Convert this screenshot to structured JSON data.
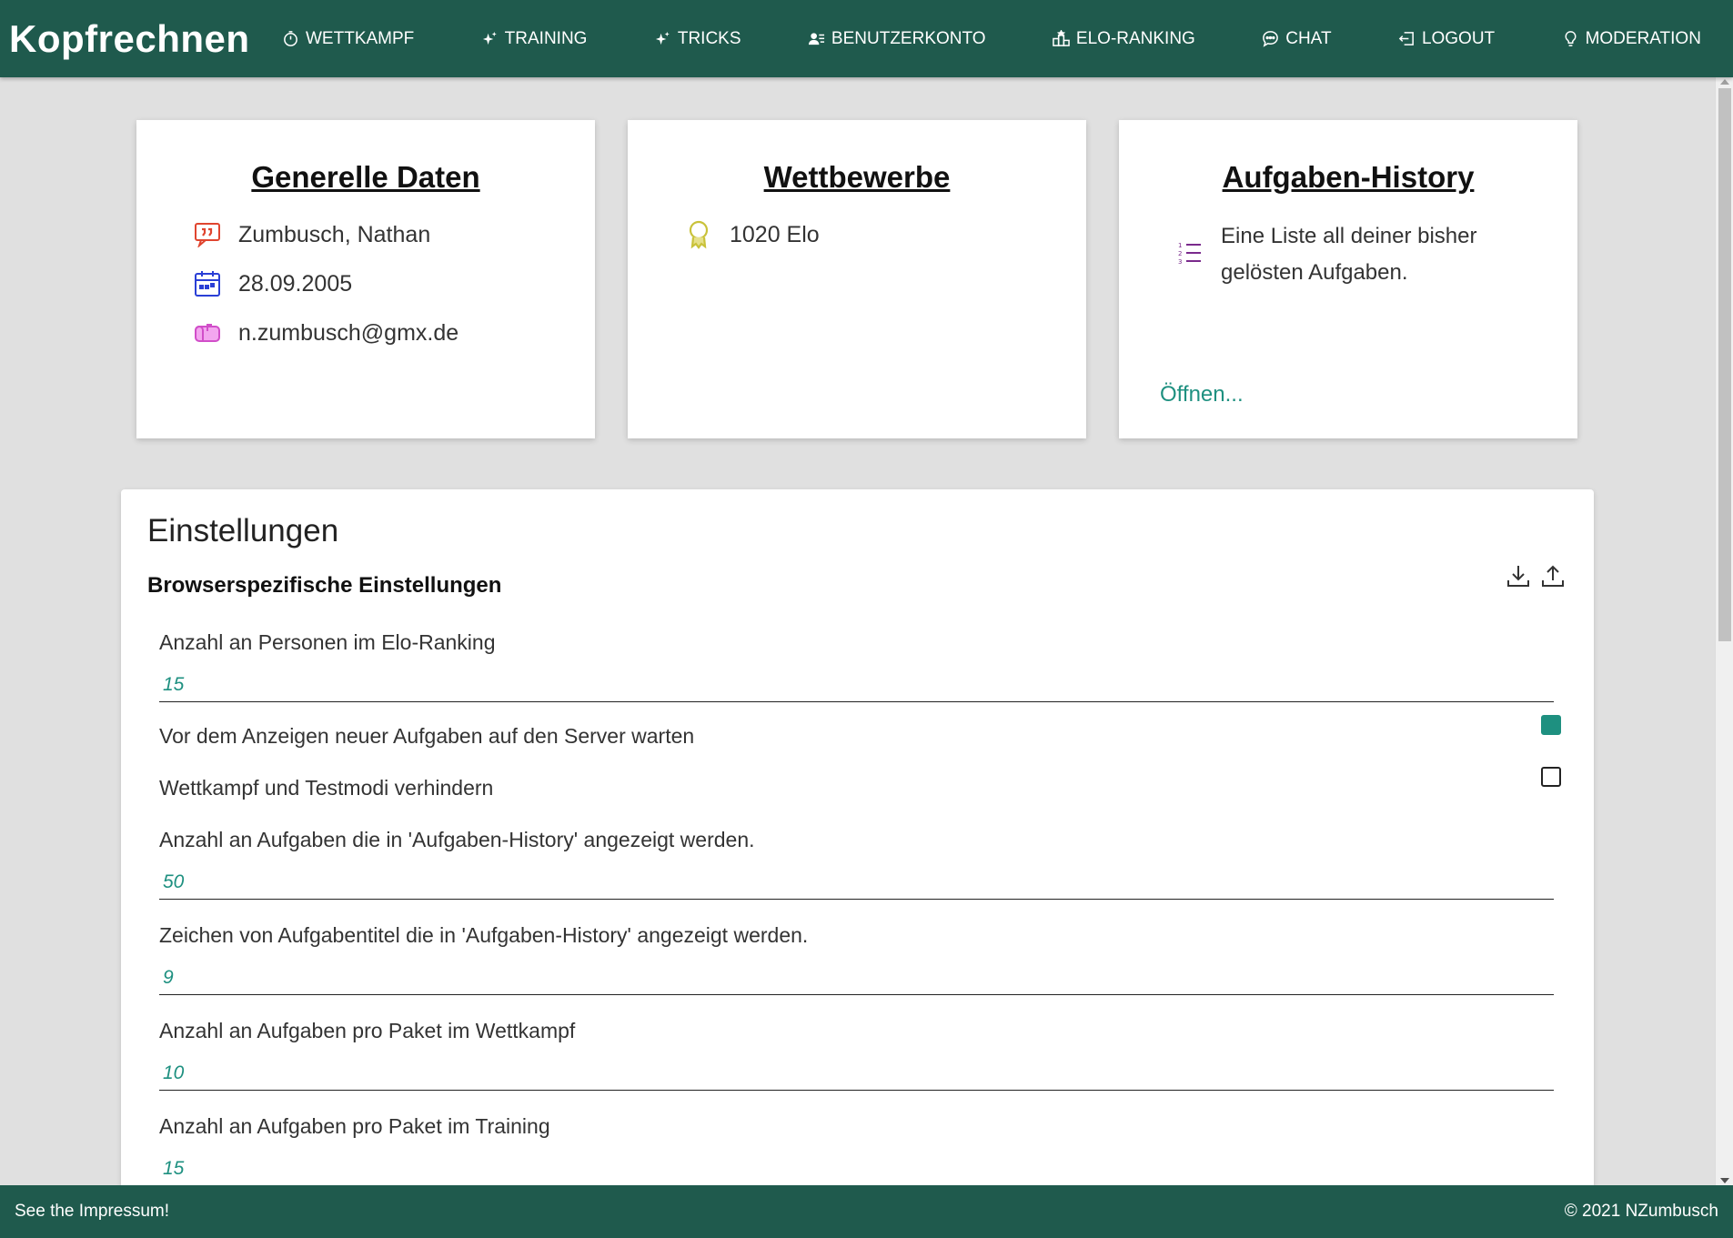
{
  "app": {
    "title": "Kopfrechnen"
  },
  "nav": [
    {
      "label": "WETTKAMPF",
      "icon": "stopwatch-icon"
    },
    {
      "label": "TRAINING",
      "icon": "sparkles-icon"
    },
    {
      "label": "TRICKS",
      "icon": "sparkles-icon"
    },
    {
      "label": "BENUTZERKONTO",
      "icon": "user-card-icon"
    },
    {
      "label": "ELO-RANKING",
      "icon": "podium-icon"
    },
    {
      "label": "CHAT",
      "icon": "chat-bubble-icon"
    },
    {
      "label": "LOGOUT",
      "icon": "logout-icon"
    },
    {
      "label": "MODERATION",
      "icon": "lightbulb-icon"
    }
  ],
  "cards": {
    "general": {
      "title": "Generelle Daten",
      "name": "Zumbusch, Nathan",
      "birthdate": "28.09.2005",
      "email": "n.zumbusch@gmx.de"
    },
    "competitions": {
      "title": "Wettbewerbe",
      "elo": "1020 Elo"
    },
    "history": {
      "title": "Aufgaben-History",
      "description": "Eine Liste all deiner bisher gelösten Aufgaben.",
      "link": "Öffnen..."
    }
  },
  "settings": {
    "title": "Einstellungen",
    "subtitle": "Browserspezifische Einstellungen",
    "fields": [
      {
        "label": "Anzahl an Personen im Elo-Ranking",
        "value": "15"
      },
      {
        "label": "Vor dem Anzeigen neuer Aufgaben auf den Server warten",
        "checked": true
      },
      {
        "label": "Wettkampf und Testmodi verhindern",
        "checked": false
      },
      {
        "label": "Anzahl an Aufgaben die in 'Aufgaben-History' angezeigt werden.",
        "value": "50"
      },
      {
        "label": "Zeichen von Aufgabentitel die in 'Aufgaben-History' angezeigt werden.",
        "value": "9"
      },
      {
        "label": "Anzahl an Aufgaben pro Paket im Wettkampf",
        "value": "10"
      },
      {
        "label": "Anzahl an Aufgaben pro Paket im Training",
        "value": "15"
      }
    ]
  },
  "footer": {
    "left": "See the Impressum!",
    "right": "© 2021 NZumbusch"
  },
  "colors": {
    "primary": "#1f5a4d",
    "accent": "#1e9080",
    "background": "#e0e0e0"
  }
}
